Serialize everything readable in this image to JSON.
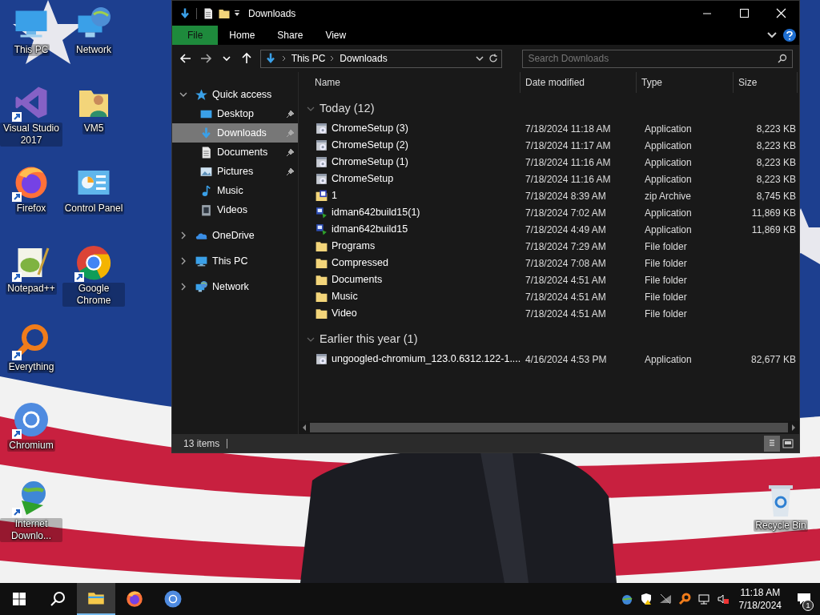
{
  "desktop_icons": [
    {
      "label": "This PC",
      "kind": "pc",
      "shortcut": false
    },
    {
      "label": "Network",
      "kind": "network",
      "shortcut": false
    },
    {
      "label": "Visual Studio 2017",
      "kind": "vs",
      "shortcut": true
    },
    {
      "label": "VM5",
      "kind": "userfolder",
      "shortcut": false
    },
    {
      "label": "Firefox",
      "kind": "firefox",
      "shortcut": true
    },
    {
      "label": "Control Panel",
      "kind": "control",
      "shortcut": false
    },
    {
      "label": "Notepad++",
      "kind": "notepad",
      "shortcut": true
    },
    {
      "label": "Google Chrome",
      "kind": "chrome",
      "shortcut": true
    },
    {
      "label": "Everything",
      "kind": "everything",
      "shortcut": true
    },
    {
      "label": "Chromium",
      "kind": "chromium",
      "shortcut": true
    },
    {
      "label": "Internet Downlo...",
      "kind": "idm",
      "shortcut": true
    },
    {
      "label": "Recycle Bin",
      "kind": "recycle",
      "shortcut": false
    }
  ],
  "window": {
    "title": "Downloads",
    "ribbon_tabs": [
      {
        "label": "File",
        "selected": true
      },
      {
        "label": "Home",
        "selected": false
      },
      {
        "label": "Share",
        "selected": false
      },
      {
        "label": "View",
        "selected": false
      }
    ],
    "address": [
      "This PC",
      "Downloads"
    ],
    "search": {
      "placeholder": "Search Downloads"
    },
    "nav": [
      {
        "label": "Quick access",
        "kind": "star",
        "expanded": true,
        "selected": false,
        "children": [
          {
            "label": "Desktop",
            "kind": "desktop",
            "pinned": true,
            "selected": false
          },
          {
            "label": "Downloads",
            "kind": "download",
            "pinned": true,
            "selected": true
          },
          {
            "label": "Documents",
            "kind": "document",
            "pinned": true,
            "selected": false
          },
          {
            "label": "Pictures",
            "kind": "pictures",
            "pinned": true,
            "selected": false
          },
          {
            "label": "Music",
            "kind": "music",
            "pinned": false,
            "selected": false
          },
          {
            "label": "Videos",
            "kind": "videos",
            "pinned": false,
            "selected": false
          }
        ]
      },
      {
        "label": "OneDrive",
        "kind": "cloud",
        "expanded": false,
        "selected": false
      },
      {
        "label": "This PC",
        "kind": "pc",
        "expanded": false,
        "selected": false
      },
      {
        "label": "Network",
        "kind": "network",
        "expanded": false,
        "selected": false
      }
    ],
    "columns": [
      "Name",
      "Date modified",
      "Type",
      "Size"
    ],
    "groups": [
      {
        "label": "Today (12)",
        "expanded": true,
        "rows": [
          {
            "name": "ChromeSetup (3)",
            "kind": "setup",
            "date": "7/18/2024 11:18 AM",
            "type": "Application",
            "size": "8,223 KB"
          },
          {
            "name": "ChromeSetup (2)",
            "kind": "setup",
            "date": "7/18/2024 11:17 AM",
            "type": "Application",
            "size": "8,223 KB"
          },
          {
            "name": "ChromeSetup (1)",
            "kind": "setup",
            "date": "7/18/2024 11:16 AM",
            "type": "Application",
            "size": "8,223 KB"
          },
          {
            "name": "ChromeSetup",
            "kind": "setup",
            "date": "7/18/2024 11:16 AM",
            "type": "Application",
            "size": "8,223 KB"
          },
          {
            "name": "1",
            "kind": "zip",
            "date": "7/18/2024 8:39 AM",
            "type": "zip Archive",
            "size": "8,745 KB"
          },
          {
            "name": "idman642build15(1)",
            "kind": "installer",
            "date": "7/18/2024 7:02 AM",
            "type": "Application",
            "size": "11,869 KB"
          },
          {
            "name": "idman642build15",
            "kind": "installer",
            "date": "7/18/2024 4:49 AM",
            "type": "Application",
            "size": "11,869 KB"
          },
          {
            "name": "Programs",
            "kind": "folder",
            "date": "7/18/2024 7:29 AM",
            "type": "File folder"
          },
          {
            "name": "Compressed",
            "kind": "folder",
            "date": "7/18/2024 7:08 AM",
            "type": "File folder"
          },
          {
            "name": "Documents",
            "kind": "folder",
            "date": "7/18/2024 4:51 AM",
            "type": "File folder"
          },
          {
            "name": "Music",
            "kind": "folder",
            "date": "7/18/2024 4:51 AM",
            "type": "File folder"
          },
          {
            "name": "Video",
            "kind": "folder",
            "date": "7/18/2024 4:51 AM",
            "type": "File folder"
          }
        ]
      },
      {
        "label": "Earlier this year (1)",
        "expanded": true,
        "rows": [
          {
            "name": "ungoogled-chromium_123.0.6312.122-1....",
            "kind": "setup",
            "date": "4/16/2024 4:53 PM",
            "type": "Application",
            "size": "82,677 KB"
          }
        ]
      }
    ],
    "status": "13 items"
  },
  "taskbar": {
    "apps": [
      {
        "kind": "explorer",
        "selected": true
      },
      {
        "kind": "firefox",
        "selected": false
      },
      {
        "kind": "chromium",
        "selected": false
      }
    ],
    "time": "11:18 AM",
    "date": "7/18/2024",
    "notifications": "1"
  }
}
